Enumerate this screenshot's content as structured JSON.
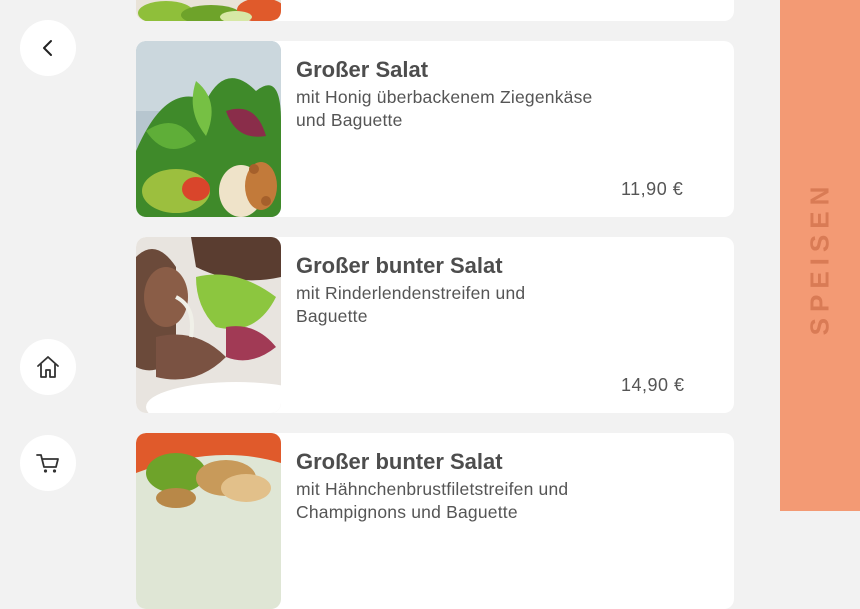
{
  "nav": {
    "back_icon": "chevron-left-icon",
    "home_icon": "home-icon",
    "cart_icon": "cart-icon"
  },
  "sidebar": {
    "label": "SPEISEN",
    "color": "#f39a74"
  },
  "menu_items": [
    {
      "price": ""
    },
    {
      "title": "Großer Salat",
      "description": "mit Honig überbackenem Ziegenkäse und Baguette",
      "price": "11,90 €"
    },
    {
      "title": "Großer bunter Salat",
      "description": "mit Rinderlendenstreifen und Baguette",
      "price": "14,90 €"
    },
    {
      "title": "Großer bunter Salat",
      "description": "mit Hähnchenbrustfiletstreifen und Champignons und Baguette"
    }
  ]
}
